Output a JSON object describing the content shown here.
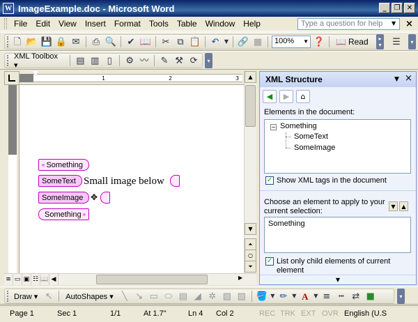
{
  "window": {
    "title": "ImageExample.doc - Microsoft Word",
    "app_icon": "W"
  },
  "menu": {
    "items": [
      "File",
      "Edit",
      "View",
      "Insert",
      "Format",
      "Tools",
      "Table",
      "Window",
      "Help"
    ],
    "help_placeholder": "Type a question for help"
  },
  "toolbar_standard": {
    "zoom": "100%",
    "read_label": "Read"
  },
  "toolbar_xml": {
    "label": "XML Toolbox"
  },
  "ruler": {
    "ticks": [
      "1",
      "2",
      "3"
    ]
  },
  "document": {
    "tags": {
      "something_open": "Something",
      "sometext_open": "SomeText",
      "someimage_open": "SomeImage",
      "something_close": "Something"
    },
    "text": "Small image below"
  },
  "task_pane": {
    "title": "XML Structure",
    "elements_label": "Elements in the document:",
    "tree": {
      "root": "Something",
      "children": [
        "SomeText",
        "SomeImage"
      ]
    },
    "show_tags_label": "Show XML tags in the document",
    "show_tags_checked": true,
    "choose_label": "Choose an element to apply to your current selection:",
    "element_list": [
      "Something"
    ],
    "list_only_label": "List only child elements of current element",
    "list_only_checked": true
  },
  "drawing_toolbar": {
    "draw_label": "Draw",
    "autoshapes_label": "AutoShapes"
  },
  "status_bar": {
    "page": "Page 1",
    "sec": "Sec 1",
    "pages": "1/1",
    "at": "At 1.7\"",
    "ln": "Ln 4",
    "col": "Col 2",
    "rec": "REC",
    "trk": "TRK",
    "ext": "EXT",
    "ovr": "OVR",
    "language": "English (U.S"
  }
}
